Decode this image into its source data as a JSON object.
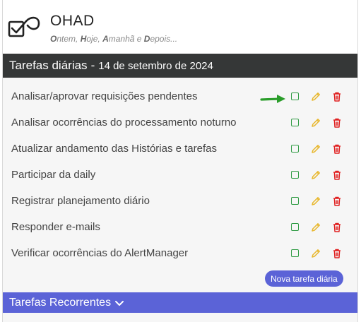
{
  "header": {
    "app_title": "OHAD",
    "tagline": [
      {
        "b": "O",
        "t": "ntem, "
      },
      {
        "b": "H",
        "t": "oje, "
      },
      {
        "b": "A",
        "t": "manhã e "
      },
      {
        "b": "D",
        "t": "epois..."
      }
    ],
    "logo_icon": "checkbox-loop-logo-icon"
  },
  "day": {
    "title": "Tarefas diárias",
    "separator": "-",
    "date": "14 de setembro de 2024"
  },
  "tasks": [
    {
      "label": "Analisar/aprovar requisições pendentes"
    },
    {
      "label": "Analisar ocorrências do processamento noturno"
    },
    {
      "label": "Atualizar andamento das Histórias e tarefas"
    },
    {
      "label": "Participar da daily"
    },
    {
      "label": "Registrar planejamento diário"
    },
    {
      "label": "Responder e-mails"
    },
    {
      "label": "Verificar ocorrências do AlertManager"
    }
  ],
  "icons": {
    "checkbox": "checkbox-icon",
    "edit": "pencil-icon",
    "delete": "trash-icon",
    "pointer": "green-arrow-icon"
  },
  "new_task_button": "Nova tarefa diária",
  "recurrent": {
    "label": "Tarefas Recorrentes",
    "icon": "chevron-down-icon"
  },
  "colors": {
    "accent": "#5b63d7",
    "bar": "#353737",
    "check": "#2f9b43",
    "edit": "#e8b830",
    "delete": "#e02020"
  }
}
